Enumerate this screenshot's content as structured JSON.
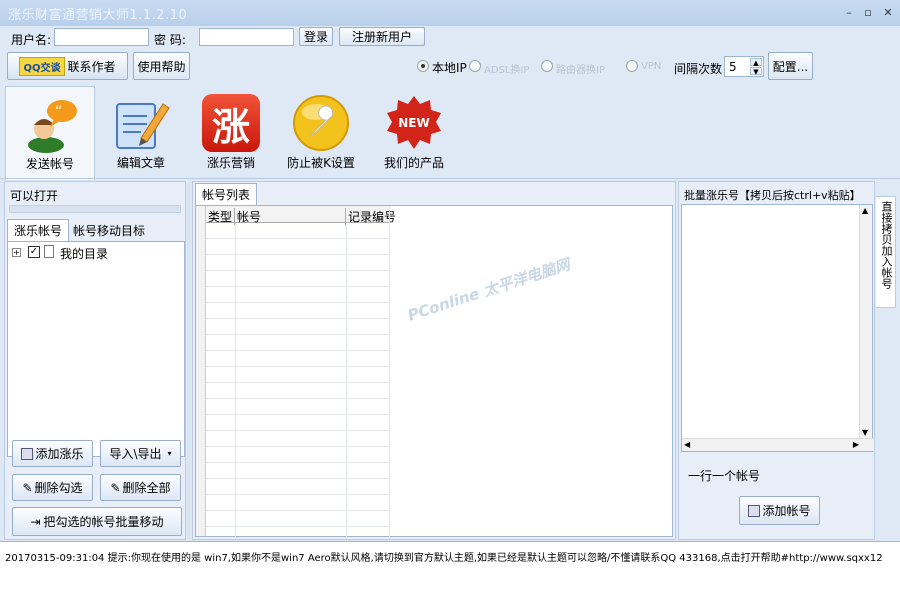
{
  "window": {
    "title": "涨乐财富通营销大师1.1.2.10"
  },
  "login": {
    "username_label": "用户名:",
    "password_label": "密  码:",
    "username_value": "",
    "password_value": "",
    "login_button": "登录",
    "register_button": "注册新用户"
  },
  "toolbar": {
    "qq_button": "QQ交谈",
    "contact_author": "联系作者",
    "help_button": "使用帮助",
    "ip_local": "本地IP",
    "ip_adsl": "ADSL换IP",
    "ip_router": "路由器换IP",
    "ip_vpn": "VPN",
    "interval_label": "间隔次数",
    "interval_value": "5",
    "config_button": "配置..."
  },
  "tools": [
    {
      "label": "发送帐号",
      "icon": "user-chat-icon"
    },
    {
      "label": "编辑文章",
      "icon": "edit-document-icon"
    },
    {
      "label": "涨乐营销",
      "icon": "zhang-logo-icon",
      "glyph": "涨"
    },
    {
      "label": "防止被K设置",
      "icon": "wrench-icon"
    },
    {
      "label": "我们的产品",
      "icon": "new-badge-icon",
      "badge": "NEW"
    }
  ],
  "left_panel": {
    "title": "可以打开",
    "tabs": [
      "涨乐帐号",
      "帐号移动目标"
    ],
    "tree": [
      {
        "label": "我的目录",
        "checked": true
      }
    ],
    "buttons": {
      "add": "添加涨乐",
      "import_export": "导入\\导出",
      "delete_checked": "删除勾选",
      "delete_all": "删除全部",
      "batch_move": "把勾选的帐号批量移动"
    }
  },
  "center_panel": {
    "tab": "帐号列表",
    "columns": [
      "类型",
      "帐号",
      "记录编号"
    ],
    "watermark": "PConline 太平洋电脑网"
  },
  "right_panel": {
    "title": "批量涨乐号【拷贝后按ctrl+v粘贴】",
    "side_tab": "直接拷贝加入帐号",
    "hint": "一行一个帐号",
    "add_button": "添加帐号"
  },
  "status": {
    "log": "20170315-09:31:04  提示:你现在使用的是 win7,如果你不是win7 Aero默认风格,请切换到官方默认主题,如果已经是默认主题可以忽略/不懂请联系QQ 433168,点击打开帮助#http://www.sqxx12"
  }
}
